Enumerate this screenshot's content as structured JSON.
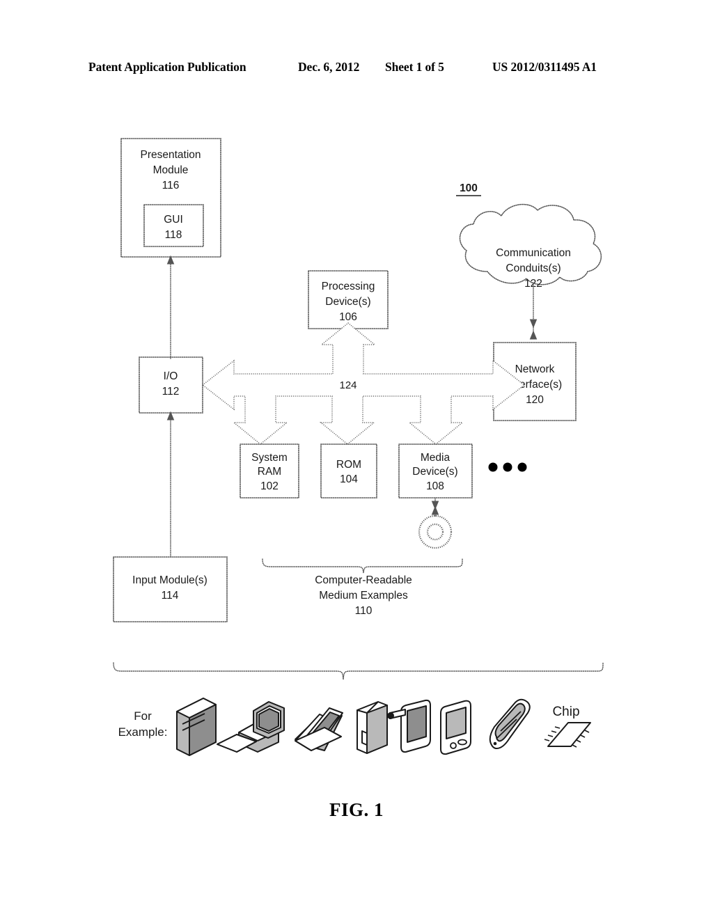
{
  "header": {
    "publication": "Patent Application Publication",
    "date": "Dec. 6, 2012",
    "sheet": "Sheet 1 of 5",
    "patent_number": "US 2012/0311495 A1"
  },
  "figure": {
    "caption": "FIG. 1",
    "system_reference": "100"
  },
  "blocks": {
    "presentation_module": {
      "line1": "Presentation",
      "line2": "Module",
      "ref": "116"
    },
    "gui": {
      "line1": "GUI",
      "ref": "118"
    },
    "processing_device": {
      "line1": "Processing",
      "line2": "Device(s)",
      "ref": "106"
    },
    "communication_conduits": {
      "line1": "Communication",
      "line2": "Conduits(s)",
      "ref": "122"
    },
    "network_interface": {
      "line1": "Network",
      "line2": "Interface(s)",
      "ref": "120"
    },
    "io": {
      "line1": "I/O",
      "ref": "112"
    },
    "system_ram": {
      "line1": "System",
      "line2": "RAM",
      "ref": "102"
    },
    "rom": {
      "line1": "ROM",
      "ref": "104"
    },
    "media_device": {
      "line1": "Media",
      "line2": "Device(s)",
      "ref": "108"
    },
    "input_module": {
      "line1": "Input Module(s)",
      "ref": "114"
    }
  },
  "bus": {
    "ref": "124"
  },
  "ellipsis": "• • •",
  "annotations": {
    "computer_readable": {
      "line1": "Computer-Readable",
      "line2": "Medium Examples",
      "ref": "110"
    },
    "for_example": {
      "line1": "For",
      "line2": "Example:"
    },
    "chip_label": "Chip"
  },
  "device_icons": [
    {
      "name": "server-tower-icon"
    },
    {
      "name": "desktop-computer-icon"
    },
    {
      "name": "laptop-icon"
    },
    {
      "name": "book-reader-icon"
    },
    {
      "name": "tablet-stylus-icon"
    },
    {
      "name": "pda-phone-icon"
    },
    {
      "name": "flip-phone-icon"
    },
    {
      "name": "chip-icon"
    }
  ]
}
